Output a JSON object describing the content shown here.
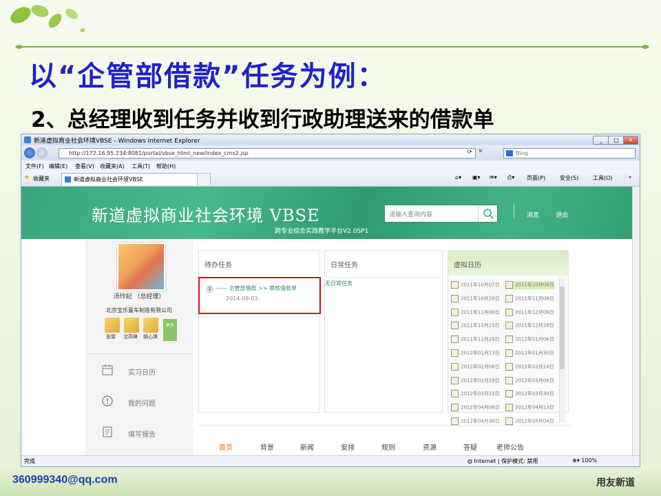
{
  "slide": {
    "title": "以“企管部借款”任务为例：",
    "subtitle": "2、总经理收到任务并收到行政助理送来的借款单",
    "footer_email": "360999340@qq.com",
    "footer_logo": "用友新道"
  },
  "ie": {
    "window_title": "新道虚拟商业社会环境VBSE - Windows Internet Explorer",
    "address": "http://172.16.95.234:8081/portal/vbse_html_new/index_cms2.jsp",
    "search_placeholder": "Bing",
    "menu": [
      "文件(F)",
      "编辑(E)",
      "查看(V)",
      "收藏夹(A)",
      "工具(T)",
      "帮助(H)"
    ],
    "favorites_label": "收藏夹",
    "tab_title": "新道虚拟商业社会环境VBSE",
    "toolbar": {
      "page": "页面(P)",
      "safety": "安全(S)",
      "tools": "工具(O)"
    },
    "status_left": "完成",
    "status_zone": "Internet | 保护模式: 禁用",
    "status_zoom": "100%"
  },
  "site": {
    "hero_title": "新道虚拟商业社会环境 VBSE",
    "hero_sub": "跨专业综合实践教学平台V2.0SP1",
    "search_placeholder": "请输入查询内容",
    "nav_msg": "消息",
    "nav_exit": "退出",
    "user_name": "汤玲妃 （总经理）",
    "company": "北京宝乐童车制造有限公司",
    "members": [
      "张雷",
      "沈高峰",
      "姚心琪"
    ],
    "member_add": "更多",
    "side_menu": [
      "实习日历",
      "我的问题",
      "填写报告"
    ],
    "todo_title": "待办任务",
    "daily_title": "日常任务",
    "calendar_title": "虚拟日历",
    "task_no": "1",
    "task_link": "—— 企管部借款 >> 审核借款单",
    "task_date": "2014-08-03",
    "daily_empty": "无日常任务",
    "calendar_left": [
      "2011年10月07日",
      "2011年10月28日",
      "2011年11月08日",
      "2011年12月15日",
      "2011年12月29日",
      "2012年01月13日",
      "2012年02月06日",
      "2012年02月29日",
      "2012年03月15日",
      "2012年04月06日",
      "2012年04月30日"
    ],
    "calendar_right": [
      "2011年10月08日",
      "2011年11月08日",
      "2011年12月08日",
      "2011年12月28日",
      "2012年01月06日",
      "2012年01月30日",
      "2012年02月14日",
      "2012年03月06日",
      "2012年03月30日",
      "2012年04月13日",
      "2012年05月04日"
    ],
    "bottom_nav": [
      "首页",
      "背景",
      "新闻",
      "安排",
      "规则",
      "资源",
      "答疑",
      "老师公告"
    ],
    "accent": "#3aa57c",
    "highlight": "#d8111a"
  }
}
